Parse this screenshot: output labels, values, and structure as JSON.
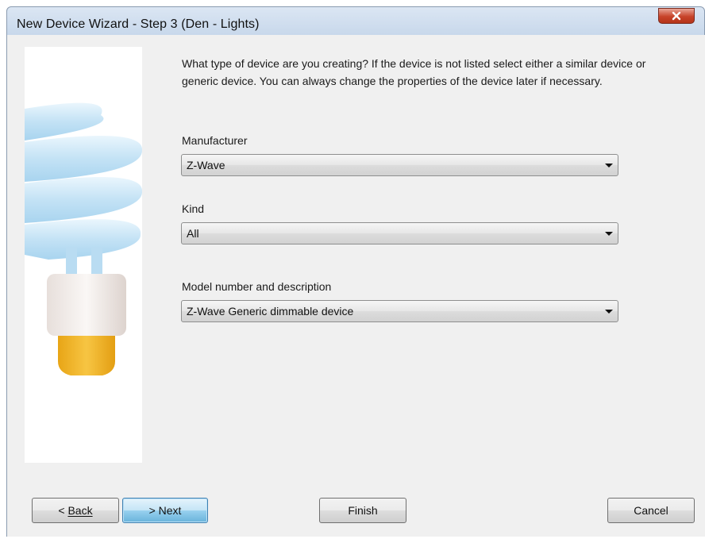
{
  "window": {
    "title": "New Device Wizard - Step 3 (Den - Lights)",
    "close_icon": "close-icon"
  },
  "instructions": "What type of device are you creating?  If the device is not listed select either a similar device or generic device.  You can always change the properties of the device later if necessary.",
  "fields": {
    "manufacturer": {
      "label": "Manufacturer",
      "value": "Z-Wave"
    },
    "kind": {
      "label": "Kind",
      "value": "All"
    },
    "model": {
      "label": "Model number and description",
      "value": "Z-Wave Generic dimmable device"
    }
  },
  "buttons": {
    "back": {
      "prefix": "< ",
      "label": "Back"
    },
    "next": "> Next",
    "finish": "Finish",
    "cancel": "Cancel"
  },
  "illustration": "light-bulb-icon",
  "colors": {
    "bulb_spiral": "#cfe8f7",
    "bulb_base": "#ece6e2",
    "bulb_cap": "#f0b323",
    "default_button": "#98d1ef",
    "close_button": "#c7432a"
  }
}
